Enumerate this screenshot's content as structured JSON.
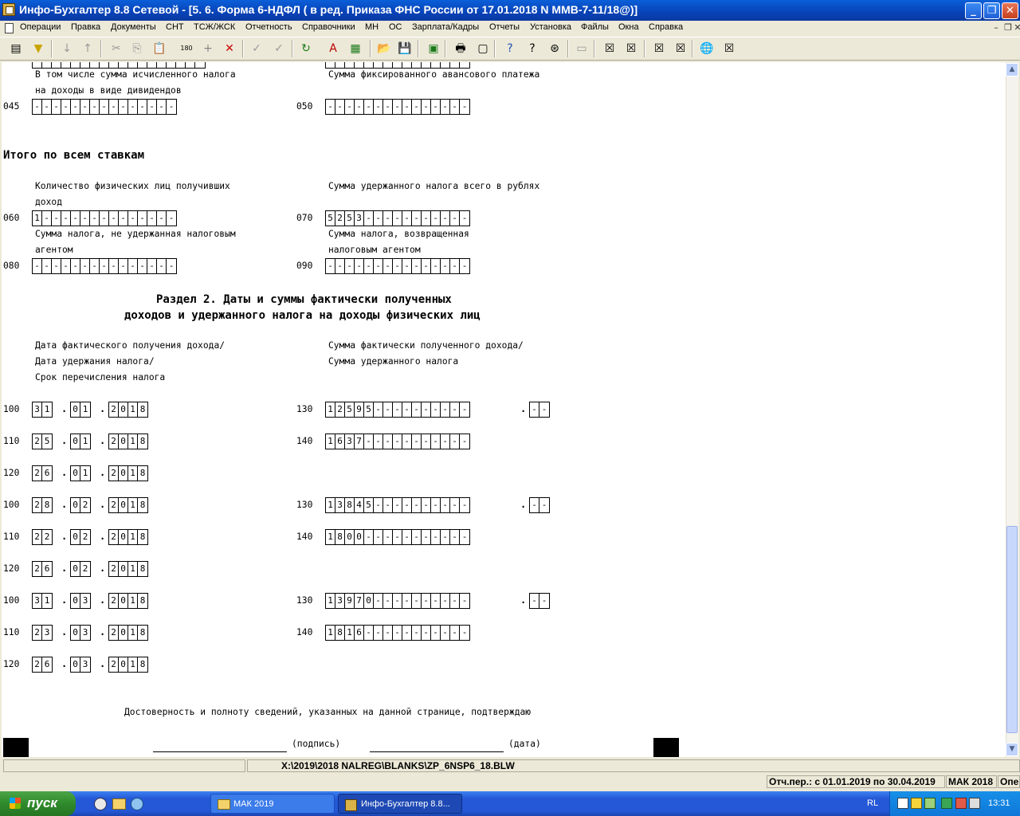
{
  "window": {
    "title": "Инфо-Бухгалтер 8.8 Сетевой - [5.  6. Форма 6-НДФЛ ( в ред. Приказа ФНС России от 17.01.2018 N ММВ-7-11/18@)]",
    "min": "_",
    "max": "❐",
    "close": "✕"
  },
  "menu": [
    "Операции",
    "Правка",
    "Документы",
    "СНТ",
    "ТСЖ/ЖСК",
    "Отчетность",
    "Справочники",
    "МН",
    "ОС",
    "Зарплата/Кадры",
    "Отчеты",
    "Установка",
    "Файлы",
    "Окна",
    "Справка"
  ],
  "mdi_controls": [
    "–",
    "❐",
    "✕"
  ],
  "toolbar": {
    "icons": [
      "list-icon",
      "filter-icon",
      "sort-asc-icon",
      "sort-desc-icon",
      "cut-icon",
      "copy-icon",
      "paste-icon",
      "counter-icon",
      "add-icon",
      "delete-icon",
      "mark-icon",
      "unmark-icon",
      "refresh-icon",
      "pdf-icon",
      "calculator-icon",
      "open-folder-icon",
      "save-icon",
      "check-icon",
      "print-icon",
      "preview-icon",
      "help-icon",
      "context-help-icon",
      "compass-icon",
      "tool-icon",
      "close-x1-icon",
      "close-x2-icon",
      "close-x3-icon",
      "close-x4-icon",
      "globe-icon",
      "close-x5-icon"
    ],
    "glyphs": [
      "▤",
      "▼",
      "↓",
      "↑",
      "✂",
      "⎘",
      "📋",
      "180",
      "+",
      "✕",
      "✓",
      "✓",
      "↻",
      "A",
      "▦",
      "📂",
      "💾",
      "▣",
      "🖶",
      "▢",
      "?",
      "?",
      "⊛",
      "▭",
      "☒",
      "☒",
      "☒",
      "☒",
      "🌐",
      "☒"
    ],
    "counter_label": "180"
  },
  "form": {
    "top_partial": {
      "left_cells": 18,
      "right_cells": 15
    },
    "l045_label1": "В том числе сумма исчисленного налога",
    "l045_label2": "на доходы в виде дивидендов",
    "l050_label": "Сумма фиксированного авансового платежа",
    "code_045": "045",
    "code_050": "050",
    "f045": "---------------",
    "f050": "---------------",
    "total_heading": "Итого по всем ставкам",
    "l060_label1": "Количество физических лиц получивших",
    "l060_label2": "доход",
    "l070_label": "Сумма удержанного налога всего в рублях",
    "code_060": "060",
    "code_070": "070",
    "f060": "1--------------",
    "f070": "5253-----------",
    "l080_label1": "Сумма налога, не удержанная налоговым",
    "l080_label2": "агентом",
    "l090_label1": "Сумма налога, возвращенная",
    "l090_label2": "налоговым агентом",
    "code_080": "080",
    "code_090": "090",
    "f080": "---------------",
    "f090": "---------------",
    "section2_title1": "Раздел 2. Даты и суммы фактически полученных",
    "section2_title2": "доходов и удержанного налога на доходы физических лиц",
    "dates_label1": "Дата фактического получения дохода/",
    "dates_label2": "Дата удержания налога/",
    "dates_label3": "Срок перечисления налога",
    "sums_label1": "Сумма фактически полученного дохода/",
    "sums_label2": "Сумма удержанного налога",
    "dot": ".",
    "blocks": [
      {
        "rows": [
          {
            "code": "100",
            "day": "31",
            "month": "01",
            "year": "2018",
            "sum_code": "130",
            "sum": "12595----------",
            "kop": "--"
          },
          {
            "code": "110",
            "day": "25",
            "month": "01",
            "year": "2018",
            "sum_code": "140",
            "sum": "1637-----------"
          },
          {
            "code": "120",
            "day": "26",
            "month": "01",
            "year": "2018"
          }
        ]
      },
      {
        "rows": [
          {
            "code": "100",
            "day": "28",
            "month": "02",
            "year": "2018",
            "sum_code": "130",
            "sum": "13845----------",
            "kop": "--"
          },
          {
            "code": "110",
            "day": "22",
            "month": "02",
            "year": "2018",
            "sum_code": "140",
            "sum": "1800-----------"
          },
          {
            "code": "120",
            "day": "26",
            "month": "02",
            "year": "2018"
          }
        ]
      },
      {
        "rows": [
          {
            "code": "100",
            "day": "31",
            "month": "03",
            "year": "2018",
            "sum_code": "130",
            "sum": "13970----------",
            "kop": "--"
          },
          {
            "code": "110",
            "day": "23",
            "month": "03",
            "year": "2018",
            "sum_code": "140",
            "sum": "1816-----------"
          },
          {
            "code": "120",
            "day": "26",
            "month": "03",
            "year": "2018"
          }
        ]
      }
    ],
    "confirm_text": "Достоверность и полноту сведений, указанных на данной странице, подтверждаю",
    "signature_label": "(подпись)",
    "date_label": "(дата)"
  },
  "status": {
    "path": "X:\\2019\\2018 NALREG\\BLANKS\\ZP_6NSP6_18.BLW",
    "period": "Отч.пер.: с 01.01.2019 по 30.04.2019",
    "org": "МАК 2018",
    "extra": "Опе"
  },
  "taskbar": {
    "start": "пуск",
    "quicklaunch": [
      "media-icon",
      "folder-icon",
      "browser-icon"
    ],
    "tasks": [
      "МАК 2019",
      "Инфо-Бухгалтер 8.8..."
    ],
    "lang": "RL",
    "clock": "13:31"
  },
  "colors": {
    "titlebar": "#0842b8",
    "taskbar": "#2458d6",
    "start": "#2f8a2b",
    "face": "#ece9d8"
  }
}
